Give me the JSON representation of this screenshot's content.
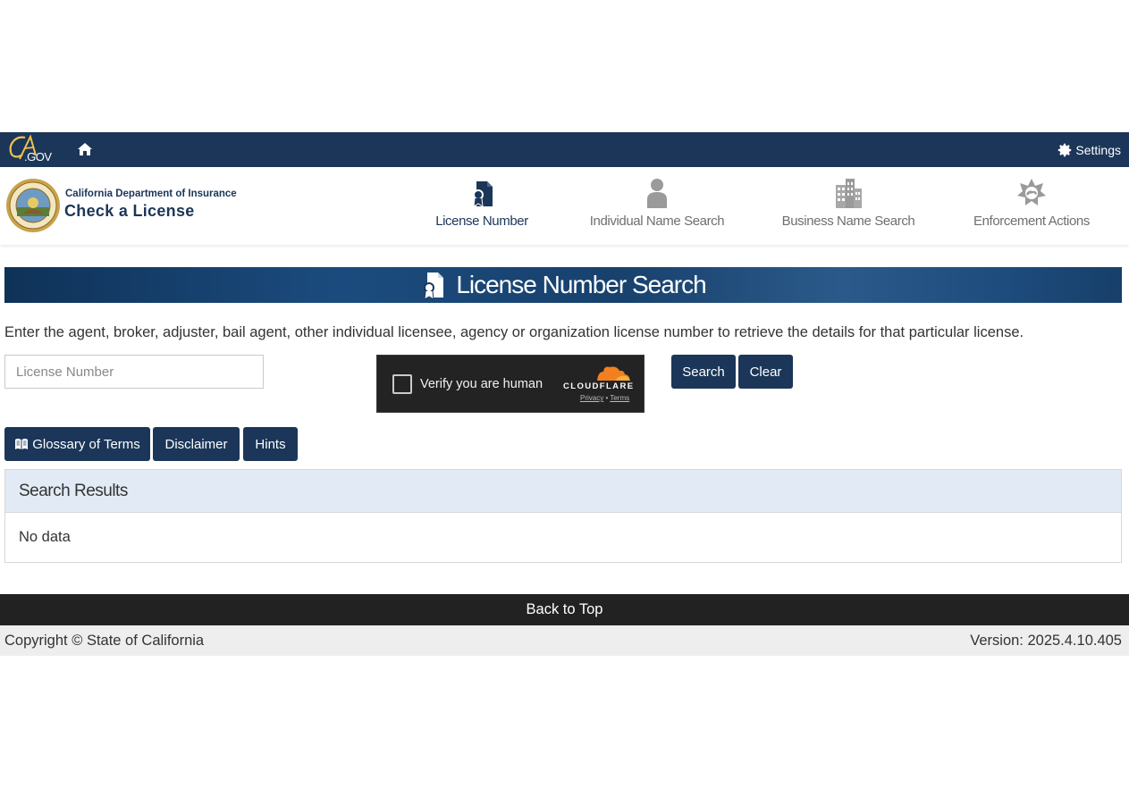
{
  "utility": {
    "cagov_text": ".GOV",
    "settings_label": "Settings"
  },
  "header": {
    "org_name": "California Department of Insurance",
    "app_title": "Check a License"
  },
  "nav": [
    {
      "label": "License Number",
      "icon": "license-document-icon",
      "active": true
    },
    {
      "label": "Individual Name Search",
      "icon": "person-icon",
      "active": false
    },
    {
      "label": "Business Name Search",
      "icon": "building-icon",
      "active": false
    },
    {
      "label": "Enforcement Actions",
      "icon": "badge-star-icon",
      "active": false
    }
  ],
  "banner": {
    "title": "License Number Search"
  },
  "instructions": "Enter the agent, broker, adjuster, bail agent, other individual licensee, agency or organization license number to retrieve the details for that particular license.",
  "search": {
    "placeholder": "License Number",
    "value": "",
    "search_label": "Search",
    "clear_label": "Clear"
  },
  "captcha": {
    "label": "Verify you are human",
    "brand": "CLOUDFLARE",
    "privacy": "Privacy",
    "separator": "•",
    "terms": "Terms"
  },
  "actions": {
    "glossary_label": "Glossary of Terms",
    "disclaimer_label": "Disclaimer",
    "hints_label": "Hints"
  },
  "results": {
    "title": "Search Results",
    "empty": "No data"
  },
  "footer": {
    "back_to_top": "Back to Top",
    "copyright": "Copyright © State of California",
    "version": "Version: 2025.4.10.405"
  },
  "colors": {
    "primary": "#1b3658",
    "results_header_bg": "#e2ebf5",
    "footer_dark": "#222222",
    "cloudflare_orange": "#f38020"
  }
}
